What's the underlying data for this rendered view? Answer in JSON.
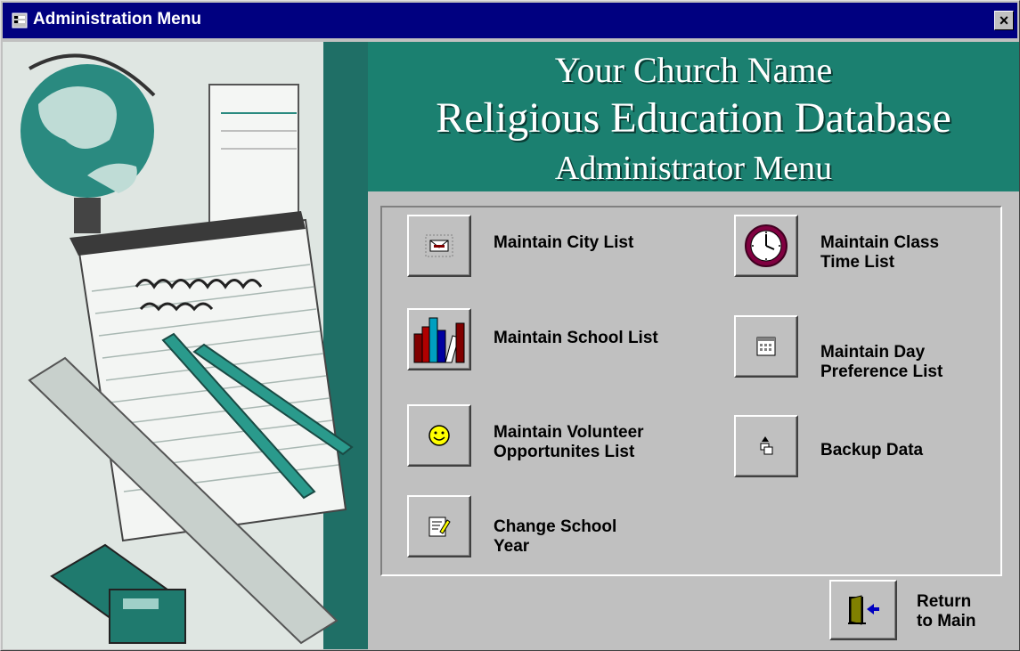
{
  "window": {
    "title": "Administration Menu",
    "close_label": "×"
  },
  "header": {
    "line1": "Your Church Name",
    "line2": "Religious Education Database",
    "line3": "Administrator Menu"
  },
  "menu": {
    "city": "Maintain City List",
    "class_time": "Maintain Class\nTime List",
    "school": "Maintain School List",
    "day_pref": "Maintain Day\nPreference List",
    "volunteer": "Maintain Volunteer\nOpportunites List",
    "backup": "Backup Data",
    "school_year": "Change School\nYear"
  },
  "footer": {
    "return": "Return\nto Main"
  },
  "icons": {
    "city": "envelope-icon",
    "class_time": "clock-icon",
    "school": "books-icon",
    "day_pref": "calendar-icon",
    "volunteer": "smiley-icon",
    "backup": "backup-icon",
    "school_year": "notepad-edit-icon",
    "return": "exit-door-icon"
  },
  "colors": {
    "titlebar": "#000080",
    "header": "#1b8070",
    "face": "#c0c0c0"
  }
}
